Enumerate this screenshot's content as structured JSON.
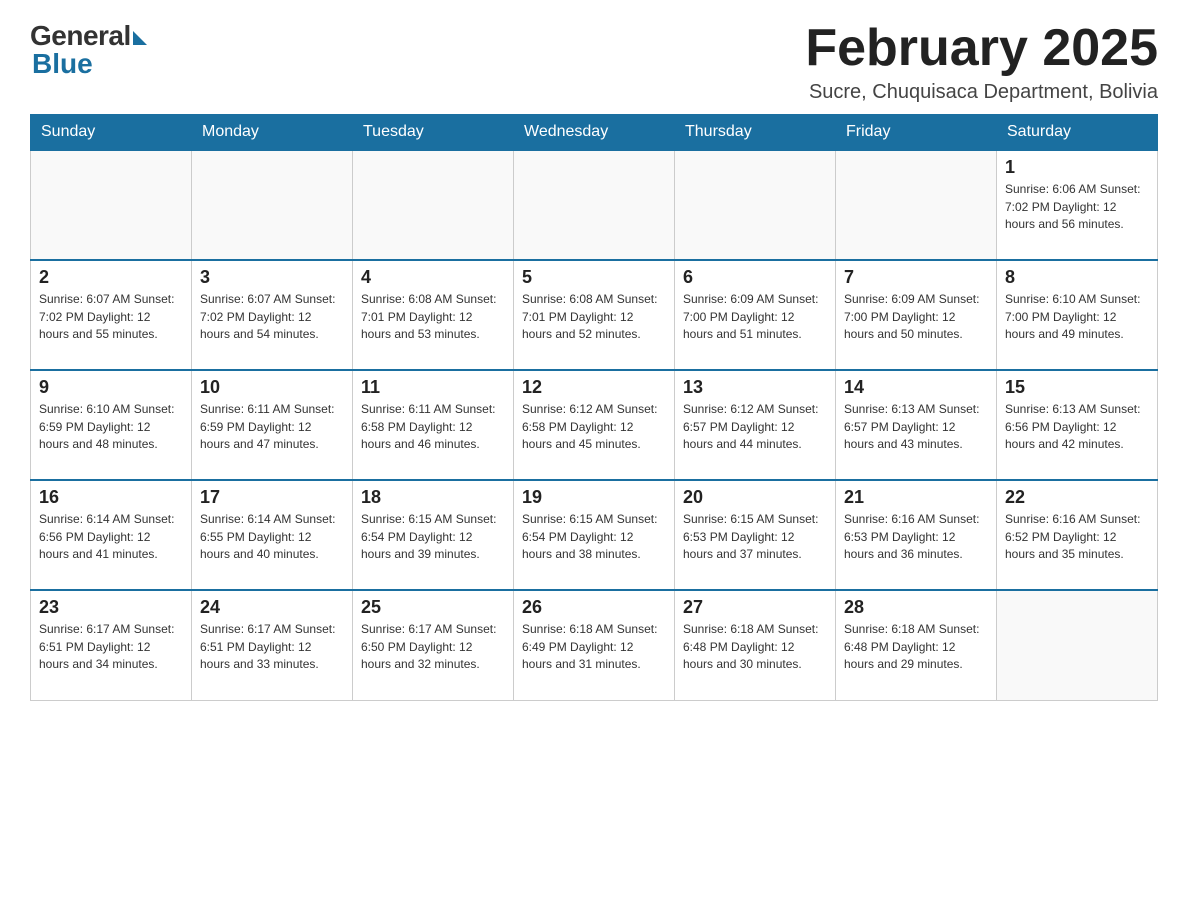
{
  "header": {
    "logo_general": "General",
    "logo_blue": "Blue",
    "month_title": "February 2025",
    "subtitle": "Sucre, Chuquisaca Department, Bolivia"
  },
  "days_of_week": [
    "Sunday",
    "Monday",
    "Tuesday",
    "Wednesday",
    "Thursday",
    "Friday",
    "Saturday"
  ],
  "weeks": [
    [
      {
        "day": "",
        "info": ""
      },
      {
        "day": "",
        "info": ""
      },
      {
        "day": "",
        "info": ""
      },
      {
        "day": "",
        "info": ""
      },
      {
        "day": "",
        "info": ""
      },
      {
        "day": "",
        "info": ""
      },
      {
        "day": "1",
        "info": "Sunrise: 6:06 AM\nSunset: 7:02 PM\nDaylight: 12 hours\nand 56 minutes."
      }
    ],
    [
      {
        "day": "2",
        "info": "Sunrise: 6:07 AM\nSunset: 7:02 PM\nDaylight: 12 hours\nand 55 minutes."
      },
      {
        "day": "3",
        "info": "Sunrise: 6:07 AM\nSunset: 7:02 PM\nDaylight: 12 hours\nand 54 minutes."
      },
      {
        "day": "4",
        "info": "Sunrise: 6:08 AM\nSunset: 7:01 PM\nDaylight: 12 hours\nand 53 minutes."
      },
      {
        "day": "5",
        "info": "Sunrise: 6:08 AM\nSunset: 7:01 PM\nDaylight: 12 hours\nand 52 minutes."
      },
      {
        "day": "6",
        "info": "Sunrise: 6:09 AM\nSunset: 7:00 PM\nDaylight: 12 hours\nand 51 minutes."
      },
      {
        "day": "7",
        "info": "Sunrise: 6:09 AM\nSunset: 7:00 PM\nDaylight: 12 hours\nand 50 minutes."
      },
      {
        "day": "8",
        "info": "Sunrise: 6:10 AM\nSunset: 7:00 PM\nDaylight: 12 hours\nand 49 minutes."
      }
    ],
    [
      {
        "day": "9",
        "info": "Sunrise: 6:10 AM\nSunset: 6:59 PM\nDaylight: 12 hours\nand 48 minutes."
      },
      {
        "day": "10",
        "info": "Sunrise: 6:11 AM\nSunset: 6:59 PM\nDaylight: 12 hours\nand 47 minutes."
      },
      {
        "day": "11",
        "info": "Sunrise: 6:11 AM\nSunset: 6:58 PM\nDaylight: 12 hours\nand 46 minutes."
      },
      {
        "day": "12",
        "info": "Sunrise: 6:12 AM\nSunset: 6:58 PM\nDaylight: 12 hours\nand 45 minutes."
      },
      {
        "day": "13",
        "info": "Sunrise: 6:12 AM\nSunset: 6:57 PM\nDaylight: 12 hours\nand 44 minutes."
      },
      {
        "day": "14",
        "info": "Sunrise: 6:13 AM\nSunset: 6:57 PM\nDaylight: 12 hours\nand 43 minutes."
      },
      {
        "day": "15",
        "info": "Sunrise: 6:13 AM\nSunset: 6:56 PM\nDaylight: 12 hours\nand 42 minutes."
      }
    ],
    [
      {
        "day": "16",
        "info": "Sunrise: 6:14 AM\nSunset: 6:56 PM\nDaylight: 12 hours\nand 41 minutes."
      },
      {
        "day": "17",
        "info": "Sunrise: 6:14 AM\nSunset: 6:55 PM\nDaylight: 12 hours\nand 40 minutes."
      },
      {
        "day": "18",
        "info": "Sunrise: 6:15 AM\nSunset: 6:54 PM\nDaylight: 12 hours\nand 39 minutes."
      },
      {
        "day": "19",
        "info": "Sunrise: 6:15 AM\nSunset: 6:54 PM\nDaylight: 12 hours\nand 38 minutes."
      },
      {
        "day": "20",
        "info": "Sunrise: 6:15 AM\nSunset: 6:53 PM\nDaylight: 12 hours\nand 37 minutes."
      },
      {
        "day": "21",
        "info": "Sunrise: 6:16 AM\nSunset: 6:53 PM\nDaylight: 12 hours\nand 36 minutes."
      },
      {
        "day": "22",
        "info": "Sunrise: 6:16 AM\nSunset: 6:52 PM\nDaylight: 12 hours\nand 35 minutes."
      }
    ],
    [
      {
        "day": "23",
        "info": "Sunrise: 6:17 AM\nSunset: 6:51 PM\nDaylight: 12 hours\nand 34 minutes."
      },
      {
        "day": "24",
        "info": "Sunrise: 6:17 AM\nSunset: 6:51 PM\nDaylight: 12 hours\nand 33 minutes."
      },
      {
        "day": "25",
        "info": "Sunrise: 6:17 AM\nSunset: 6:50 PM\nDaylight: 12 hours\nand 32 minutes."
      },
      {
        "day": "26",
        "info": "Sunrise: 6:18 AM\nSunset: 6:49 PM\nDaylight: 12 hours\nand 31 minutes."
      },
      {
        "day": "27",
        "info": "Sunrise: 6:18 AM\nSunset: 6:48 PM\nDaylight: 12 hours\nand 30 minutes."
      },
      {
        "day": "28",
        "info": "Sunrise: 6:18 AM\nSunset: 6:48 PM\nDaylight: 12 hours\nand 29 minutes."
      },
      {
        "day": "",
        "info": ""
      }
    ]
  ]
}
